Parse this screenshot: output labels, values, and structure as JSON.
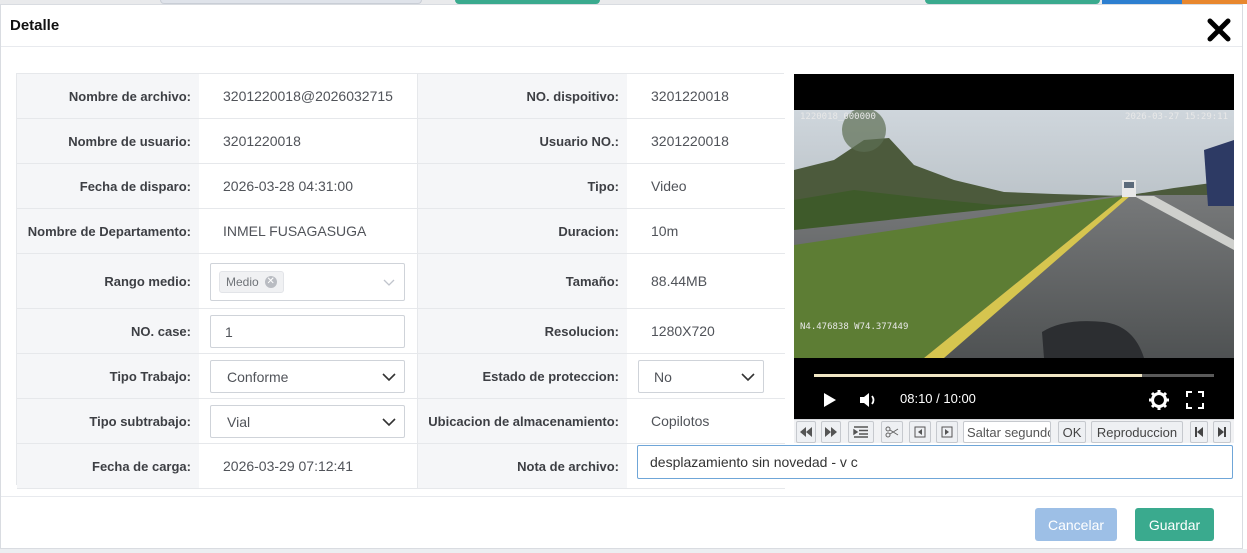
{
  "dialog": {
    "title": "Detalle"
  },
  "fields": {
    "nombre_archivo": {
      "label": "Nombre de archivo:",
      "value": "3201220018@2026032715"
    },
    "no_dispositivo": {
      "label": "NO. dispoitivo:",
      "value": "3201220018"
    },
    "nombre_usuario": {
      "label": "Nombre de usuario:",
      "value": "3201220018"
    },
    "usuario_no": {
      "label": "Usuario NO.:",
      "value": "3201220018"
    },
    "fecha_disparo": {
      "label": "Fecha de disparo:",
      "value": "2026-03-28 04:31:00"
    },
    "tipo": {
      "label": "Tipo:",
      "value": "Video"
    },
    "departamento": {
      "label": "Nombre de Departamento:",
      "value": "INMEL FUSAGASUGA"
    },
    "duracion": {
      "label": "Duracion:",
      "value": "10m"
    },
    "rango_medio": {
      "label": "Rango medio:",
      "tag": "Medio"
    },
    "tamano": {
      "label": "Tamaño:",
      "value": "88.44MB"
    },
    "no_case": {
      "label": "NO. case:",
      "value": "1"
    },
    "resolucion": {
      "label": "Resolucion:",
      "value": "1280X720"
    },
    "tipo_trabajo": {
      "label": "Tipo Trabajo:",
      "value": "Conforme"
    },
    "estado_proteccion": {
      "label": "Estado de proteccion:",
      "value": "No"
    },
    "tipo_subtrabajo": {
      "label": "Tipo subtrabajo:",
      "value": "Vial"
    },
    "ubicacion": {
      "label": "Ubicacion de almacenamiento:",
      "value": "Copilotos"
    },
    "fecha_carga": {
      "label": "Fecha de carga:",
      "value": "2026-03-29 07:12:41"
    },
    "nota_archivo": {
      "label": "Nota de archivo:",
      "value": "desplazamiento sin novedad - v c"
    }
  },
  "player": {
    "osd_top_left": "1220018_000000",
    "osd_top_right": "2026-03-27 15:29:11",
    "osd_coords": "N4.476838  W74.377449",
    "time": "08:10 / 10:00",
    "progress": 0.82
  },
  "toolbar": {
    "skip_seconds": "Saltar segundos",
    "ok": "OK",
    "playback": "Reproduccion"
  },
  "buttons": {
    "cancel": "Cancelar",
    "save": "Guardar"
  },
  "colors": {
    "save": "#3aaa8e",
    "cancel": "#9dbfe6",
    "accent_border": "#6fa6d8"
  }
}
